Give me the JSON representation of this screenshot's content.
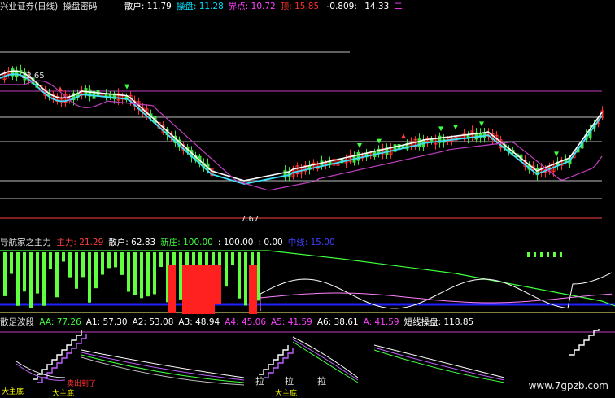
{
  "title_bar": {
    "stock_name": "兴业证券(日线)",
    "indicator": "操盘密码",
    "items": [
      {
        "label": "散户:",
        "value": "11.79",
        "color": "#ffffff"
      },
      {
        "label": "操盘:",
        "value": "11.28",
        "color": "#00e0ff"
      },
      {
        "label": "界点:",
        "value": "10.72",
        "color": "#ff40ff"
      },
      {
        "label": "顶:",
        "value": "15.85",
        "color": "#ff3030"
      },
      {
        "label": "",
        "value": "-0.809:",
        "color": "#ffffff"
      },
      {
        "label": "",
        "value": "14.33",
        "color": "#ffffff"
      },
      {
        "label": "二",
        "value": "",
        "color": "#ff40ff"
      }
    ]
  },
  "price_panel": {
    "high_label": "13.65",
    "low_label": "7.67"
  },
  "mid_panel": {
    "name": "导航家之主力",
    "items": [
      {
        "label": "主力:",
        "value": "21.29",
        "color": "#ff4040"
      },
      {
        "label": "散户:",
        "value": "62.83",
        "color": "#ffffff"
      },
      {
        "label": "新庄:",
        "value": "100.00",
        "color": "#40ff40"
      },
      {
        "label": ":",
        "value": "100.00",
        "color": "#ffffff"
      },
      {
        "label": ":",
        "value": "0.00",
        "color": "#ffffff"
      },
      {
        "label": "中线:",
        "value": "15.00",
        "color": "#4040ff"
      }
    ]
  },
  "bottom_panel": {
    "name": "散足波段",
    "items": [
      {
        "label": "AA:",
        "value": "77.26",
        "color": "#40ff40"
      },
      {
        "label": "A1:",
        "value": "57.30",
        "color": "#ffffff"
      },
      {
        "label": "A2:",
        "value": "53.08",
        "color": "#ffffff"
      },
      {
        "label": "A3:",
        "value": "48.94",
        "color": "#ffffff"
      },
      {
        "label": "A4:",
        "value": "45.06",
        "color": "#ff40ff"
      },
      {
        "label": "A5:",
        "value": "41.59",
        "color": "#ff40ff"
      },
      {
        "label": "A6:",
        "value": "38.61",
        "color": "#ffffff"
      },
      {
        "label": "A:",
        "value": "41.59",
        "color": "#ff40ff"
      },
      {
        "label": "短线操盘:",
        "value": "118.85",
        "color": "#ffffff"
      }
    ],
    "annotations": [
      "拉",
      "拉",
      "拉",
      "大主底",
      "大主底",
      "大主底",
      "卖出到了"
    ]
  },
  "watermark": "www.7gpzb.com",
  "colors": {
    "up": "#ff3030",
    "down": "#40e040",
    "ma_cyan": "#40e0ff",
    "ma_white": "#ffffff",
    "ma_purple": "#c040c0",
    "grid": "#c0c0c0"
  }
}
